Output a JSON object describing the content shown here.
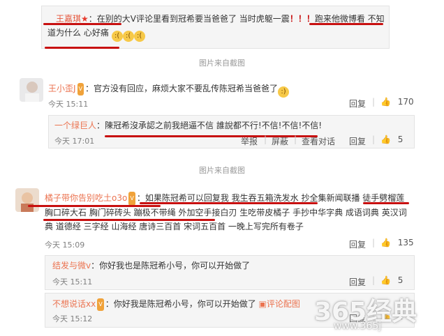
{
  "top_comment": {
    "author": "__王嘉琪",
    "star": "★",
    "text_a": "：在别的大V评论里看到冠希要当爸爸了 当时虎躯一震",
    "bangs": "！！！",
    "text_b": "跑来他微博看 不知",
    "text_c": "道为什么 心好痛"
  },
  "captions": {
    "c1": "图片来自截图",
    "c2": "图片来自截图"
  },
  "comment1": {
    "author": "王小歪J",
    "text": "：官方没有回应，麻烦大家不要乱传陈冠希当爸爸了",
    "time": "今天 15:11",
    "reply": "回复",
    "likes": "170"
  },
  "reply1": {
    "author": "一个绿巨人",
    "text": "：陳冠希沒承認之前我絕逼不信 誰說都不行!不信!不信!不信!",
    "time": "今天 17:01",
    "report": "举报",
    "block": "屏蔽",
    "view": "查看对话",
    "reply": "回复",
    "likes": "5"
  },
  "comment2": {
    "author": "橘子带你告别吃土o3o",
    "line1": "：如果陈冠希可以回复我 我生吞五箱洗发水 抄全集新闻联播 徒手劈榴莲",
    "line2": "胸口碎大石 胸门碎砖头 蹦极不带绳 外加空手接白刃 生吃带皮橘子 手抄中华字典 成语词典 英汉词",
    "line3": "典 道德经 三字经 山海经 唐诗三百首 宋词五百首 一晚上写完所有卷子",
    "time": "今天 15:09",
    "reply": "回复",
    "likes": "135"
  },
  "reply2": {
    "author": "结发与微v",
    "text": "：你好我也是陈冠希小号，你可以开始做了",
    "time": "今天 15:11",
    "reply": "回复",
    "likes": "5"
  },
  "reply3": {
    "author": "不想说话xx",
    "text": "：你好我是陈冠希小号，你可以开始做了",
    "extra": "评论配图",
    "time": "今天 15:12",
    "reply": "回复",
    "likes": "2"
  },
  "watermark": {
    "main": "365经典",
    "sub": "www.365j"
  },
  "icons": {
    "thumb": "thumbs-up-icon",
    "photo": "photo-icon",
    "avatar": "avatar-image"
  }
}
